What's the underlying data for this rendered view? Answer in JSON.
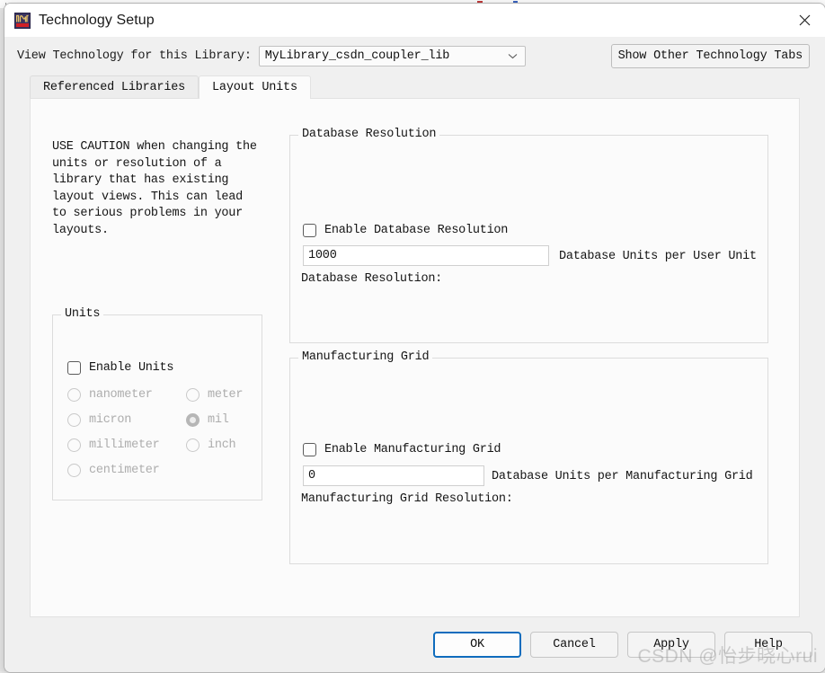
{
  "window": {
    "title": "Technology Setup",
    "icon": "waveform-app-icon",
    "close_icon": "close-icon"
  },
  "toolbar": {
    "library_label": "View Technology for this Library:",
    "library_value": "MyLibrary_csdn_coupler_lib",
    "library_dropdown_icon": "chevron-down-icon",
    "show_other_tabs_label": "Show Other Technology Tabs"
  },
  "tabs": [
    {
      "label": "Referenced Libraries",
      "active": false
    },
    {
      "label": "Layout Units",
      "active": true
    }
  ],
  "caution": {
    "text": "USE CAUTION when changing the units or resolution of a library that has existing layout views. This can lead to serious problems in your layouts."
  },
  "units_group": {
    "legend": "Units",
    "enable_label": "Enable Units",
    "enable_checked": false,
    "options_left": [
      {
        "label": "nanometer",
        "selected": false
      },
      {
        "label": "micron",
        "selected": false
      },
      {
        "label": "millimeter",
        "selected": false
      },
      {
        "label": "centimeter",
        "selected": false
      }
    ],
    "options_right": [
      {
        "label": "meter",
        "selected": false
      },
      {
        "label": "mil",
        "selected": true
      },
      {
        "label": "inch",
        "selected": false
      }
    ]
  },
  "database_resolution_group": {
    "legend": "Database Resolution",
    "enable_label": "Enable Database Resolution",
    "enable_checked": false,
    "value": "1000",
    "units_label": "Database Units per User Unit",
    "resolution_label": "Database Resolution:"
  },
  "manufacturing_grid_group": {
    "legend": "Manufacturing Grid",
    "enable_label": "Enable Manufacturing Grid",
    "enable_checked": false,
    "value": "0",
    "units_label": "Database Units per Manufacturing Grid",
    "resolution_label": "Manufacturing Grid Resolution:"
  },
  "footer": {
    "ok_label": "OK",
    "cancel_label": "Cancel",
    "apply_label": "Apply",
    "help_label": "Help"
  },
  "watermark": {
    "text": "CSDN @怡步晓心rui"
  },
  "colors": {
    "accent": "#0f6cbd",
    "icon_bg": "#3a3560",
    "icon_wave": "#e8c46a",
    "icon_bar": "#cf2026",
    "disabled_text": "#adadad",
    "panel_bg": "#fbfbfb",
    "dialog_bg": "#f0f0f0"
  }
}
